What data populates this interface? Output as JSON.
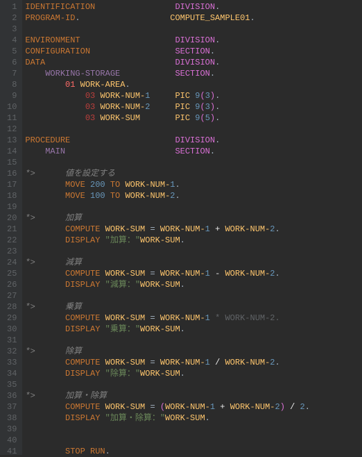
{
  "lines": [
    {
      "n": 1,
      "tokens": [
        {
          "t": "IDENTIFICATION",
          "c": "kw",
          "pad": 30
        },
        {
          "t": "DIVISION",
          "c": "pink"
        },
        {
          "t": ".",
          "c": "punc"
        }
      ]
    },
    {
      "n": 2,
      "tokens": [
        {
          "t": "PROGRAM-ID",
          "c": "kw"
        },
        {
          "t": ".",
          "c": "punc",
          "pad": 19
        },
        {
          "t": "COMPUTE_SAMPLE01",
          "c": "id"
        },
        {
          "t": ".",
          "c": "punc"
        }
      ]
    },
    {
      "n": 3,
      "tokens": []
    },
    {
      "n": 4,
      "tokens": [
        {
          "t": "ENVIRONMENT",
          "c": "kw",
          "pad": 30
        },
        {
          "t": "DIVISION",
          "c": "pink"
        },
        {
          "t": ".",
          "c": "punc"
        }
      ]
    },
    {
      "n": 5,
      "tokens": [
        {
          "t": "CONFIGURATION",
          "c": "kw",
          "pad": 30
        },
        {
          "t": "SECTION",
          "c": "pink"
        },
        {
          "t": ".",
          "c": "punc"
        }
      ]
    },
    {
      "n": 6,
      "tokens": [
        {
          "t": "DATA",
          "c": "kw",
          "pad": 30
        },
        {
          "t": "DIVISION",
          "c": "pink"
        },
        {
          "t": ".",
          "c": "punc"
        }
      ]
    },
    {
      "n": 7,
      "tokens": [
        {
          "t": "    ",
          "c": "punc"
        },
        {
          "t": "WORKING-STORAGE",
          "c": "blue",
          "pad": 26
        },
        {
          "t": "SECTION",
          "c": "pink"
        },
        {
          "t": ".",
          "c": "punc"
        }
      ]
    },
    {
      "n": 8,
      "tokens": [
        {
          "t": "        ",
          "c": "punc"
        },
        {
          "t": "01",
          "c": "lvl"
        },
        {
          "t": " ",
          "c": "punc"
        },
        {
          "t": "WORK-AREA",
          "c": "id"
        },
        {
          "t": ".",
          "c": "punc"
        }
      ]
    },
    {
      "n": 9,
      "tokens": [
        {
          "t": "            ",
          "c": "punc"
        },
        {
          "t": "03",
          "c": "red2"
        },
        {
          "t": " ",
          "c": "punc"
        },
        {
          "t": "WORK-NUM-",
          "c": "id"
        },
        {
          "t": "1",
          "c": "num",
          "pad": 6
        },
        {
          "t": "PIC",
          "c": "id"
        },
        {
          "t": " ",
          "c": "punc"
        },
        {
          "t": "9",
          "c": "num"
        },
        {
          "t": "(",
          "c": "pink"
        },
        {
          "t": "3",
          "c": "num"
        },
        {
          "t": ")",
          "c": "pink"
        },
        {
          "t": ".",
          "c": "punc"
        }
      ]
    },
    {
      "n": 10,
      "tokens": [
        {
          "t": "            ",
          "c": "punc"
        },
        {
          "t": "03",
          "c": "red2"
        },
        {
          "t": " ",
          "c": "punc"
        },
        {
          "t": "WORK-NUM-",
          "c": "id"
        },
        {
          "t": "2",
          "c": "num",
          "pad": 6
        },
        {
          "t": "PIC",
          "c": "id"
        },
        {
          "t": " ",
          "c": "punc"
        },
        {
          "t": "9",
          "c": "num"
        },
        {
          "t": "(",
          "c": "pink"
        },
        {
          "t": "3",
          "c": "num"
        },
        {
          "t": ")",
          "c": "pink"
        },
        {
          "t": ".",
          "c": "punc"
        }
      ]
    },
    {
      "n": 11,
      "tokens": [
        {
          "t": "            ",
          "c": "punc"
        },
        {
          "t": "03",
          "c": "red2"
        },
        {
          "t": " ",
          "c": "punc"
        },
        {
          "t": "WORK-SUM",
          "c": "id",
          "pad": 15
        },
        {
          "t": "PIC",
          "c": "id"
        },
        {
          "t": " ",
          "c": "punc"
        },
        {
          "t": "9",
          "c": "num"
        },
        {
          "t": "(",
          "c": "pink"
        },
        {
          "t": "5",
          "c": "num"
        },
        {
          "t": ")",
          "c": "pink"
        },
        {
          "t": ".",
          "c": "punc"
        }
      ]
    },
    {
      "n": 12,
      "tokens": []
    },
    {
      "n": 13,
      "tokens": [
        {
          "t": "PROCEDURE",
          "c": "kw",
          "pad": 30
        },
        {
          "t": "DIVISION",
          "c": "pink"
        },
        {
          "t": ".",
          "c": "punc"
        }
      ]
    },
    {
      "n": 14,
      "tokens": [
        {
          "t": "    ",
          "c": "punc"
        },
        {
          "t": "MAIN",
          "c": "blue",
          "pad": 26
        },
        {
          "t": "SECTION",
          "c": "pink"
        },
        {
          "t": ".",
          "c": "punc"
        }
      ]
    },
    {
      "n": 15,
      "tokens": []
    },
    {
      "n": 16,
      "tokens": [
        {
          "t": "*>      値を設定する",
          "c": "cmt"
        }
      ]
    },
    {
      "n": 17,
      "tokens": [
        {
          "t": "        ",
          "c": "punc"
        },
        {
          "t": "MOVE",
          "c": "kw"
        },
        {
          "t": " ",
          "c": "punc"
        },
        {
          "t": "200",
          "c": "num"
        },
        {
          "t": " ",
          "c": "punc"
        },
        {
          "t": "TO",
          "c": "kw"
        },
        {
          "t": " ",
          "c": "punc"
        },
        {
          "t": "WORK-NUM-",
          "c": "id"
        },
        {
          "t": "1",
          "c": "num"
        },
        {
          "t": ".",
          "c": "punc"
        }
      ]
    },
    {
      "n": 18,
      "tokens": [
        {
          "t": "        ",
          "c": "punc"
        },
        {
          "t": "MOVE",
          "c": "kw"
        },
        {
          "t": " ",
          "c": "punc"
        },
        {
          "t": "100",
          "c": "num"
        },
        {
          "t": " ",
          "c": "punc"
        },
        {
          "t": "TO",
          "c": "kw"
        },
        {
          "t": " ",
          "c": "punc"
        },
        {
          "t": "WORK-NUM-",
          "c": "id"
        },
        {
          "t": "2",
          "c": "num"
        },
        {
          "t": ".",
          "c": "punc"
        }
      ]
    },
    {
      "n": 19,
      "tokens": []
    },
    {
      "n": 20,
      "tokens": [
        {
          "t": "*>      加算",
          "c": "cmt"
        }
      ]
    },
    {
      "n": 21,
      "tokens": [
        {
          "t": "        ",
          "c": "punc"
        },
        {
          "t": "COMPUTE",
          "c": "kw"
        },
        {
          "t": " ",
          "c": "punc"
        },
        {
          "t": "WORK-SUM",
          "c": "id"
        },
        {
          "t": " = ",
          "c": "punc"
        },
        {
          "t": "WORK-NUM-",
          "c": "id"
        },
        {
          "t": "1",
          "c": "num"
        },
        {
          "t": " + ",
          "c": "white"
        },
        {
          "t": "WORK-NUM-",
          "c": "id"
        },
        {
          "t": "2",
          "c": "num"
        },
        {
          "t": ".",
          "c": "punc"
        }
      ]
    },
    {
      "n": 22,
      "tokens": [
        {
          "t": "        ",
          "c": "punc"
        },
        {
          "t": "DISPLAY",
          "c": "kw"
        },
        {
          "t": " ",
          "c": "punc"
        },
        {
          "t": "\"加算：\"",
          "c": "str"
        },
        {
          "t": "WORK-SUM",
          "c": "id"
        },
        {
          "t": ".",
          "c": "punc"
        }
      ]
    },
    {
      "n": 23,
      "tokens": []
    },
    {
      "n": 24,
      "tokens": [
        {
          "t": "*>      減算",
          "c": "cmt"
        }
      ]
    },
    {
      "n": 25,
      "tokens": [
        {
          "t": "        ",
          "c": "punc"
        },
        {
          "t": "COMPUTE",
          "c": "kw"
        },
        {
          "t": " ",
          "c": "punc"
        },
        {
          "t": "WORK-SUM",
          "c": "id"
        },
        {
          "t": " = ",
          "c": "punc"
        },
        {
          "t": "WORK-NUM-",
          "c": "id"
        },
        {
          "t": "1",
          "c": "num"
        },
        {
          "t": " - ",
          "c": "white"
        },
        {
          "t": "WORK-NUM-",
          "c": "id"
        },
        {
          "t": "2",
          "c": "num"
        },
        {
          "t": ".",
          "c": "punc"
        }
      ]
    },
    {
      "n": 26,
      "tokens": [
        {
          "t": "        ",
          "c": "punc"
        },
        {
          "t": "DISPLAY",
          "c": "kw"
        },
        {
          "t": " ",
          "c": "punc"
        },
        {
          "t": "\"減算：\"",
          "c": "str"
        },
        {
          "t": "WORK-SUM",
          "c": "id"
        },
        {
          "t": ".",
          "c": "punc"
        }
      ]
    },
    {
      "n": 27,
      "tokens": []
    },
    {
      "n": 28,
      "tokens": [
        {
          "t": "*>      乗算",
          "c": "cmt"
        }
      ]
    },
    {
      "n": 29,
      "tokens": [
        {
          "t": "        ",
          "c": "punc"
        },
        {
          "t": "COMPUTE",
          "c": "kw"
        },
        {
          "t": " ",
          "c": "punc"
        },
        {
          "t": "WORK-SUM",
          "c": "id"
        },
        {
          "t": " = ",
          "c": "punc"
        },
        {
          "t": "WORK-NUM-",
          "c": "id"
        },
        {
          "t": "1",
          "c": "num"
        },
        {
          "t": " * ",
          "c": "gray"
        },
        {
          "t": "WORK-NUM-2.",
          "c": "gray"
        }
      ]
    },
    {
      "n": 30,
      "tokens": [
        {
          "t": "        ",
          "c": "punc"
        },
        {
          "t": "DISPLAY",
          "c": "kw"
        },
        {
          "t": " ",
          "c": "punc"
        },
        {
          "t": "\"乗算：\"",
          "c": "str"
        },
        {
          "t": "WORK-SUM",
          "c": "id"
        },
        {
          "t": ".",
          "c": "punc"
        }
      ]
    },
    {
      "n": 31,
      "tokens": []
    },
    {
      "n": 32,
      "tokens": [
        {
          "t": "*>      除算",
          "c": "cmt"
        }
      ]
    },
    {
      "n": 33,
      "tokens": [
        {
          "t": "        ",
          "c": "punc"
        },
        {
          "t": "COMPUTE",
          "c": "kw"
        },
        {
          "t": " ",
          "c": "punc"
        },
        {
          "t": "WORK-SUM",
          "c": "id"
        },
        {
          "t": " = ",
          "c": "punc"
        },
        {
          "t": "WORK-NUM-",
          "c": "id"
        },
        {
          "t": "1",
          "c": "num"
        },
        {
          "t": " / ",
          "c": "white"
        },
        {
          "t": "WORK-NUM-",
          "c": "id"
        },
        {
          "t": "2",
          "c": "num"
        },
        {
          "t": ".",
          "c": "punc"
        }
      ]
    },
    {
      "n": 34,
      "tokens": [
        {
          "t": "        ",
          "c": "punc"
        },
        {
          "t": "DISPLAY",
          "c": "kw"
        },
        {
          "t": " ",
          "c": "punc"
        },
        {
          "t": "\"除算：\"",
          "c": "str"
        },
        {
          "t": "WORK-SUM",
          "c": "id"
        },
        {
          "t": ".",
          "c": "punc"
        }
      ]
    },
    {
      "n": 35,
      "tokens": []
    },
    {
      "n": 36,
      "tokens": [
        {
          "t": "*>      加算・除算",
          "c": "cmt"
        }
      ]
    },
    {
      "n": 37,
      "tokens": [
        {
          "t": "        ",
          "c": "punc"
        },
        {
          "t": "COMPUTE",
          "c": "kw"
        },
        {
          "t": " ",
          "c": "punc"
        },
        {
          "t": "WORK-SUM",
          "c": "id"
        },
        {
          "t": " = ",
          "c": "punc"
        },
        {
          "t": "(",
          "c": "pink"
        },
        {
          "t": "WORK-NUM-",
          "c": "id"
        },
        {
          "t": "1",
          "c": "num"
        },
        {
          "t": " + ",
          "c": "white"
        },
        {
          "t": "WORK-NUM-",
          "c": "id"
        },
        {
          "t": "2",
          "c": "num"
        },
        {
          "t": ")",
          "c": "pink"
        },
        {
          "t": " / ",
          "c": "white"
        },
        {
          "t": "2",
          "c": "num"
        },
        {
          "t": ".",
          "c": "punc"
        }
      ]
    },
    {
      "n": 38,
      "tokens": [
        {
          "t": "        ",
          "c": "punc"
        },
        {
          "t": "DISPLAY",
          "c": "kw"
        },
        {
          "t": " ",
          "c": "punc"
        },
        {
          "t": "\"加算・除算：\"",
          "c": "str"
        },
        {
          "t": "WORK-SUM",
          "c": "id"
        },
        {
          "t": ".",
          "c": "punc"
        }
      ]
    },
    {
      "n": 39,
      "tokens": []
    },
    {
      "n": 40,
      "tokens": []
    },
    {
      "n": 41,
      "tokens": [
        {
          "t": "        ",
          "c": "punc"
        },
        {
          "t": "STOP",
          "c": "kw"
        },
        {
          "t": " ",
          "c": "punc"
        },
        {
          "t": "RUN",
          "c": "kw"
        },
        {
          "t": ".",
          "c": "punc"
        }
      ]
    }
  ]
}
